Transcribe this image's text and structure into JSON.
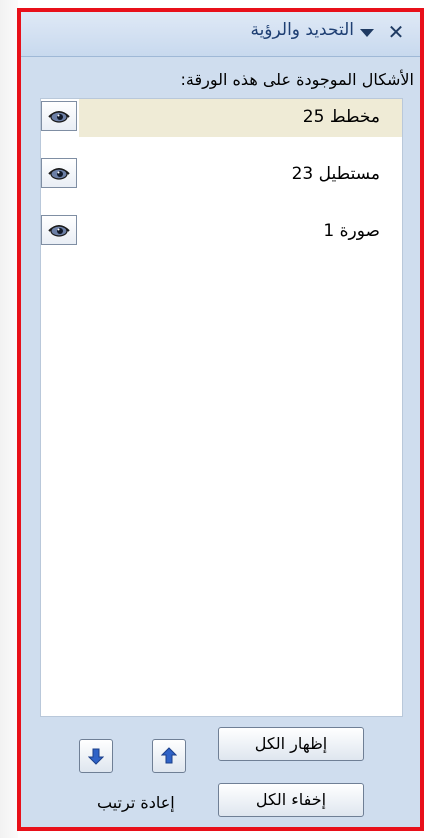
{
  "pane": {
    "title": "التحديد والرؤية",
    "close_glyph": "✕",
    "dropdown_icon": "triangle-down-icon"
  },
  "shapes_label": "الأشكال الموجودة على هذه الورقة:",
  "shapes": [
    {
      "label": "مخطط 25",
      "selected": true,
      "visible": true
    },
    {
      "label": "مستطيل 23",
      "selected": false,
      "visible": true
    },
    {
      "label": "صورة 1",
      "selected": false,
      "visible": true
    }
  ],
  "buttons": {
    "show_all": "إظهار الكل",
    "hide_all": "إخفاء الكل",
    "reorder_label": "إعادة ترتيب"
  },
  "colors": {
    "frame_border": "#e8101a",
    "pane_background": "#cfddee",
    "selection": "#efebd6",
    "title_text": "#1e3f73"
  }
}
